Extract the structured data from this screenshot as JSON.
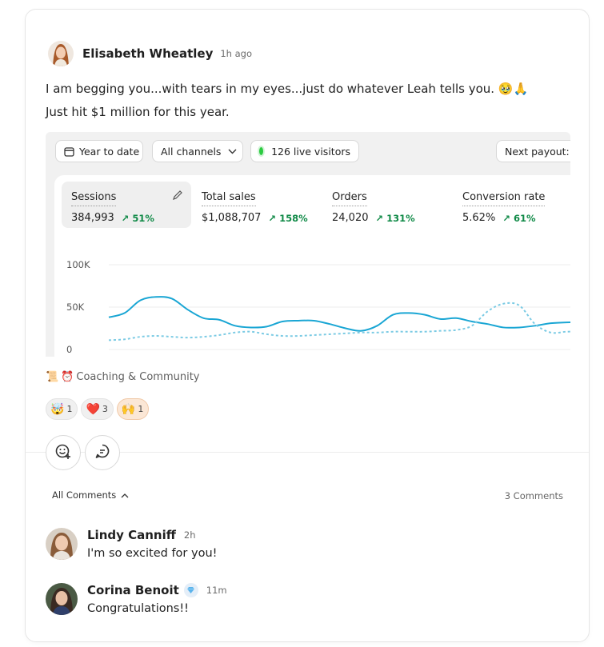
{
  "post": {
    "author": "Elisabeth Wheatley",
    "time": "1h ago",
    "line1": "I am begging you...with tears in my eyes...just do whatever Leah tells you. 🥹🙏",
    "line2": "Just hit $1 million for this year."
  },
  "dashboard": {
    "filters": {
      "date": "Year to date",
      "channels": "All channels",
      "live": "126 live visitors",
      "payout": "Next payout:"
    },
    "metrics": [
      {
        "label": "Sessions",
        "value": "384,993",
        "change": "51%"
      },
      {
        "label": "Total sales",
        "value": "$1,088,707",
        "change": "158%"
      },
      {
        "label": "Orders",
        "value": "24,020",
        "change": "131%"
      },
      {
        "label": "Conversion rate",
        "value": "5.62%",
        "change": "61%"
      }
    ],
    "y_ticks": [
      "100K",
      "50K",
      "0"
    ]
  },
  "chart_data": {
    "type": "line",
    "ylim": [
      0,
      100000
    ],
    "grid": true,
    "series": [
      {
        "values": [
          38000,
          43000,
          58000,
          62000,
          60000,
          47000,
          37000,
          35000,
          28000,
          26000,
          27000,
          33000,
          34000,
          34000,
          30000,
          25000,
          22000,
          28000,
          41000,
          43000,
          41000,
          36000,
          37000,
          33000,
          30000,
          26000,
          26000,
          28000,
          31000,
          32000,
          32000
        ]
      },
      {
        "values": [
          11000,
          12000,
          15000,
          16000,
          15000,
          14000,
          15000,
          17000,
          20000,
          21000,
          18000,
          16000,
          16000,
          17000,
          18000,
          19000,
          20000,
          20000,
          21000,
          21000,
          21000,
          22000,
          23000,
          28000,
          45000,
          54000,
          52000,
          30000,
          20000,
          21000,
          21000
        ]
      }
    ]
  },
  "category": "Coaching & Community",
  "reactions": [
    {
      "emoji": "🤯",
      "count": "1"
    },
    {
      "emoji": "❤️",
      "count": "3"
    },
    {
      "emoji": "🙌",
      "count": "1"
    }
  ],
  "comments_section": {
    "toggle_label": "All Comments",
    "count_label": "3 Comments"
  },
  "comments": [
    {
      "author": "Lindy Canniff",
      "time": "2h",
      "text": "I'm so excited for you!"
    },
    {
      "author": "Corina Benoit",
      "time": "11m",
      "text": "Congratulations!!"
    }
  ],
  "icons": {
    "react": "add-emoji-icon",
    "comment": "comment-icon",
    "gem": "gem-badge-icon"
  },
  "colors": {
    "accent_line": "#1aa6d4",
    "positive": "#108a47",
    "live_dot": "#2ccb41"
  }
}
